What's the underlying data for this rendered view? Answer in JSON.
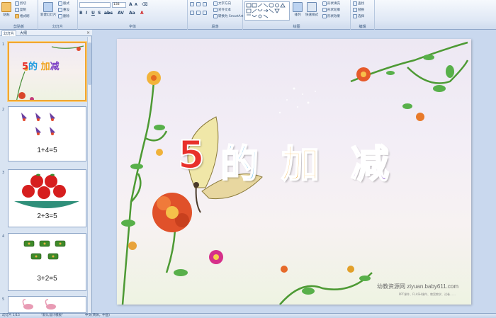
{
  "ribbon": {
    "groups": [
      "剪贴板",
      "幻灯片",
      "字体",
      "段落",
      "绘图",
      "编辑"
    ],
    "paste_label": "粘贴",
    "cut_label": "剪切",
    "copy_label": "复制",
    "format_painter_label": "格式刷",
    "new_slide_label": "新建幻灯片",
    "layout_label": "版式",
    "reset_label": "重设",
    "delete_label": "删除",
    "font_size_value": "138",
    "text_direction_label": "文字方向",
    "align_text_label": "对齐文本",
    "smartart_label": "转换为 SmartArt",
    "arrange_label": "排列",
    "quick_styles_label": "快速样式",
    "shape_fill_label": "形状填充",
    "shape_outline_label": "形状轮廓",
    "shape_effects_label": "形状效果",
    "find_label": "查找",
    "replace_label": "替换",
    "select_label": "选择"
  },
  "panel": {
    "tab_slides": "幻灯片",
    "tab_outline": "大纲",
    "close_glyph": "×",
    "slides": [
      {
        "num": "1",
        "title": "5的加减"
      },
      {
        "num": "2",
        "equation": "1+4=5"
      },
      {
        "num": "3",
        "equation": "2+3=5"
      },
      {
        "num": "4",
        "equation": "3+2=5"
      },
      {
        "num": "5"
      }
    ]
  },
  "slide": {
    "title_chars": [
      "5",
      "的",
      "加",
      "减"
    ],
    "title_colors": [
      "#e8302a",
      "#1e9be0",
      "#f0a21c",
      "#7b3fc4"
    ],
    "watermark": "幼教资源网 ziyuan.baby611.com",
    "watermark_sub": "PPT课件、FLASH课件、教案教学、试卷……"
  },
  "status": {
    "slide_counter": "幻灯片 1/15",
    "theme": "\"默认设计模板\"",
    "language": "中文(简体，中国)"
  }
}
